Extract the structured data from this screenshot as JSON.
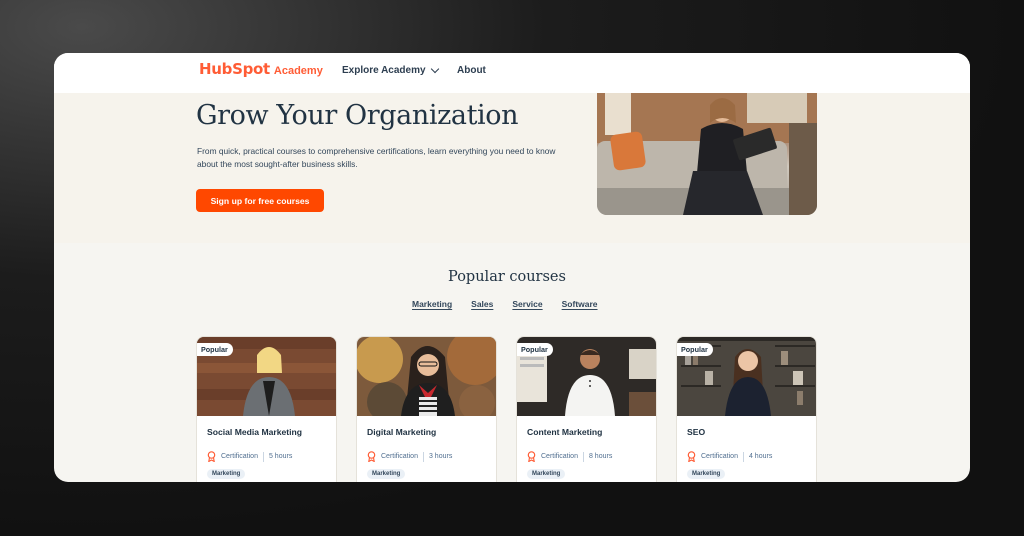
{
  "nav": {
    "logo_brand": "HubSpot",
    "logo_sub": "Academy",
    "explore_label": "Explore Academy",
    "about_label": "About"
  },
  "hero": {
    "title": "Grow Your Organization",
    "description": "From quick, practical courses to comprehensive certifications, learn everything you need to know about the most sought-after business skills.",
    "cta_label": "Sign up for free courses"
  },
  "courses": {
    "title": "Popular courses",
    "filters": [
      "Marketing",
      "Sales",
      "Service",
      "Software"
    ],
    "items": [
      {
        "badge": "Popular",
        "title": "Social Media Marketing",
        "type": "Certification",
        "duration": "5 hours",
        "tag": "Marketing"
      },
      {
        "badge": "",
        "title": "Digital Marketing",
        "type": "Certification",
        "duration": "3 hours",
        "tag": "Marketing"
      },
      {
        "badge": "Popular",
        "title": "Content Marketing",
        "type": "Certification",
        "duration": "8 hours",
        "tag": "Marketing"
      },
      {
        "badge": "Popular",
        "title": "SEO",
        "type": "Certification",
        "duration": "4 hours",
        "tag": "Marketing"
      }
    ]
  },
  "colors": {
    "brand_orange": "#ff5c35",
    "cta_orange": "#ff4800",
    "heading_navy": "#213343"
  }
}
